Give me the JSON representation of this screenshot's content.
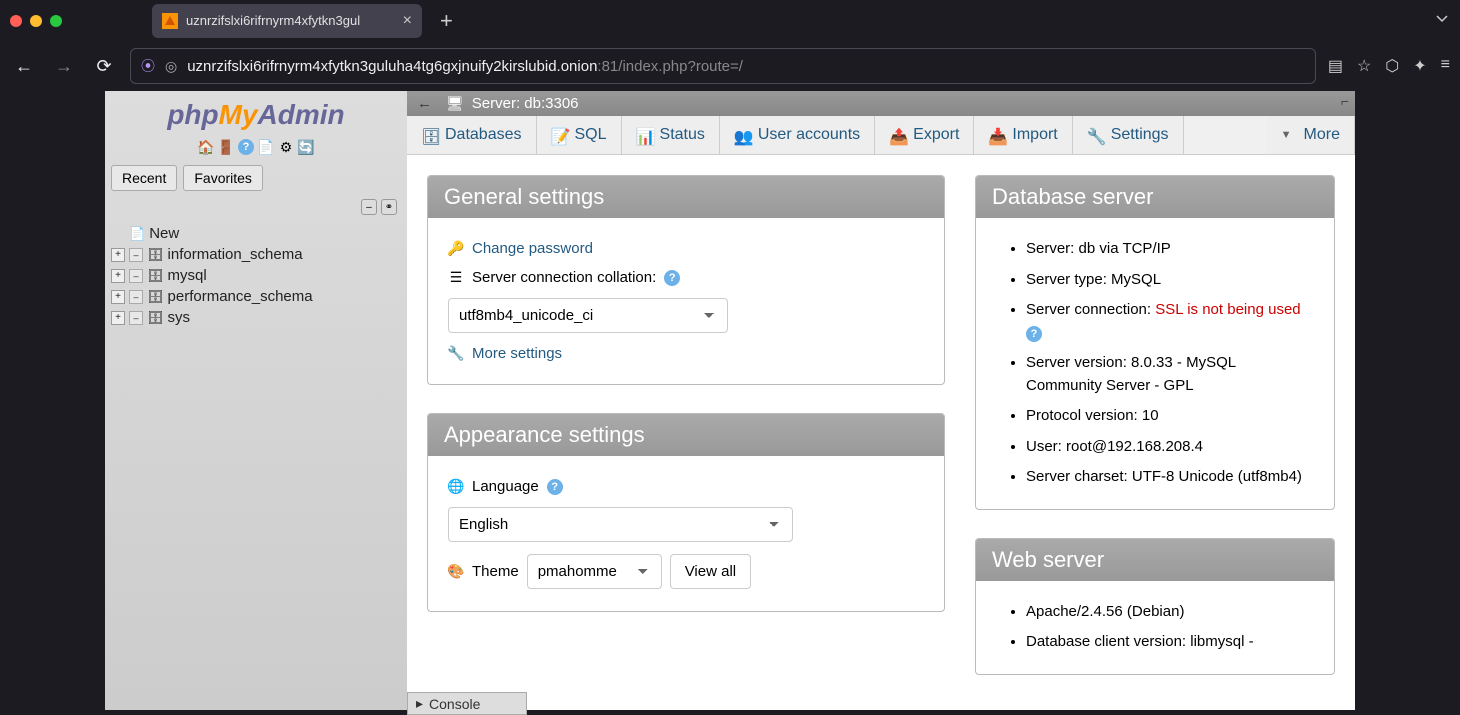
{
  "browser": {
    "tab_title": "uznrzifslxi6rifrnyrm4xfytkn3gul",
    "url_host": "uznrzifslxi6rifrnyrm4xfytkn3guluha4tg6gxjnuify2kirslubid.onion",
    "url_port_path": ":81/index.php?route=/"
  },
  "logo": {
    "php": "php",
    "my": "My",
    "admin": "Admin"
  },
  "sidebar": {
    "recent": "Recent",
    "favorites": "Favorites",
    "new": "New",
    "databases": [
      "information_schema",
      "mysql",
      "performance_schema",
      "sys"
    ]
  },
  "server_bar": "Server: db:3306",
  "topnav": {
    "databases": "Databases",
    "sql": "SQL",
    "status": "Status",
    "user_accounts": "User accounts",
    "export": "Export",
    "import": "Import",
    "settings": "Settings",
    "more": "More"
  },
  "general": {
    "title": "General settings",
    "change_password": "Change password",
    "collation_label": "Server connection collation:",
    "collation_value": "utf8mb4_unicode_ci",
    "more_settings": "More settings"
  },
  "appearance": {
    "title": "Appearance settings",
    "language_label": "Language",
    "language_value": "English",
    "theme_label": "Theme",
    "theme_value": "pmahomme",
    "view_all": "View all"
  },
  "db_server": {
    "title": "Database server",
    "items": {
      "server": "Server: db via TCP/IP",
      "type": "Server type: MySQL",
      "connection_label": "Server connection: ",
      "connection_warn": "SSL is not being used",
      "version": "Server version: 8.0.33 - MySQL Community Server - GPL",
      "protocol": "Protocol version: 10",
      "user": "User: root@192.168.208.4",
      "charset": "Server charset: UTF-8 Unicode (utf8mb4)"
    }
  },
  "web_server": {
    "title": "Web server",
    "apache": "Apache/2.4.56 (Debian)",
    "client": "Database client version: libmysql -"
  },
  "console": "Console"
}
